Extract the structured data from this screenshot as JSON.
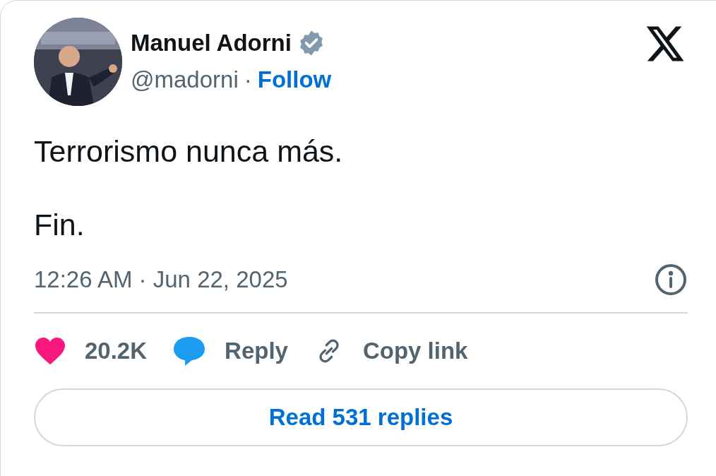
{
  "author": {
    "name": "Manuel Adorni",
    "verified": true,
    "handle": "@madorni",
    "separator": "·",
    "follow": "Follow"
  },
  "paragraphs": [
    "Terrorismo nunca más.",
    "Fin."
  ],
  "timestamp": "12:26 AM · Jun 22, 2025",
  "actions": [
    {
      "kind": "like",
      "label": "20.2K"
    },
    {
      "kind": "reply",
      "label": "Reply"
    },
    {
      "kind": "copy",
      "label": "Copy link"
    }
  ],
  "read_replies": "Read 531 replies"
}
